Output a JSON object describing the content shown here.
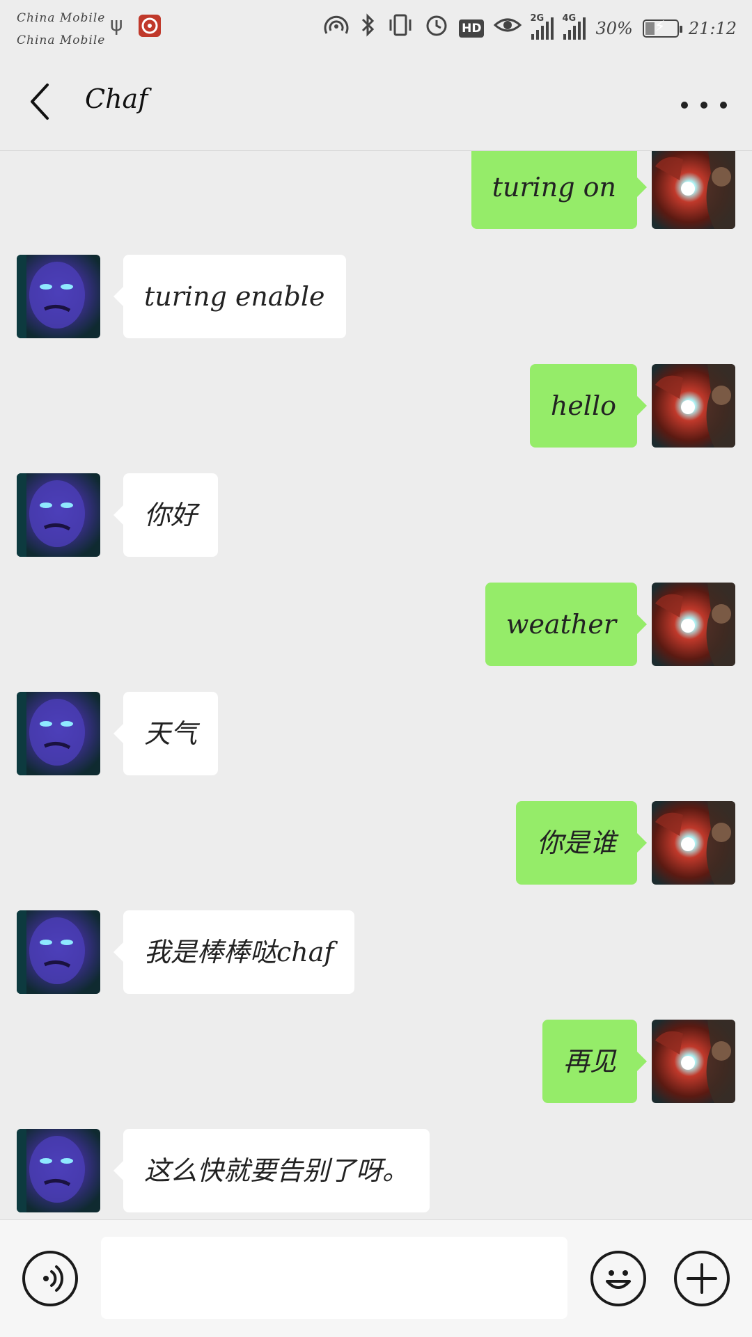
{
  "status_bar": {
    "carrier_1": "China Mobile",
    "carrier_2": "China Mobile",
    "battery_percent": "30%",
    "battery_level": 0.3,
    "time": "21:12",
    "network_1": "2G",
    "network_2": "4G",
    "hd_label": "HD",
    "icons": [
      "usb-icon",
      "app-notification-icon",
      "hotspot-icon",
      "bluetooth-icon",
      "vibrate-icon",
      "alarm-icon",
      "hd-icon",
      "eye-comfort-icon",
      "signal-2g-icon",
      "signal-4g-icon",
      "battery-charging-icon"
    ]
  },
  "header": {
    "title": "Chaf",
    "back_icon": "chevron-left-icon",
    "more_icon": "more-dots-icon"
  },
  "messages": [
    {
      "side": "out",
      "text": "turing on"
    },
    {
      "side": "in",
      "text": "turing enable"
    },
    {
      "side": "out",
      "text": "hello"
    },
    {
      "side": "in",
      "text": "你好"
    },
    {
      "side": "out",
      "text": "weather"
    },
    {
      "side": "in",
      "text": "天气"
    },
    {
      "side": "out",
      "text": "你是谁"
    },
    {
      "side": "in",
      "text": "我是棒棒哒chaf"
    },
    {
      "side": "out",
      "text": "再见"
    },
    {
      "side": "in",
      "text": "这么快就要告别了呀。"
    }
  ],
  "input_bar": {
    "voice_icon": "voice-input-icon",
    "emoji_icon": "emoji-icon",
    "plus_icon": "add-icon",
    "input_value": ""
  },
  "colors": {
    "outgoing_bubble": "#95ec69",
    "incoming_bubble": "#ffffff",
    "background": "#ededed"
  }
}
